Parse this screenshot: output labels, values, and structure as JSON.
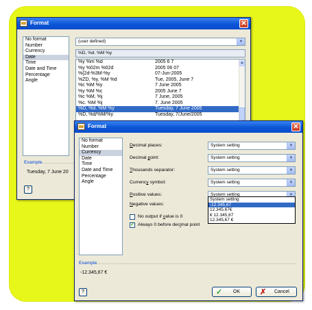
{
  "colors": {
    "backdrop": "#e8f71a",
    "title_blue": "#0b55d6",
    "selection": "#316ac5"
  },
  "back_window": {
    "title": "Format",
    "categories": [
      "No format",
      "Number",
      "Currency",
      "Date",
      "Time",
      "Date and Time",
      "Percentage",
      "Angle"
    ],
    "selected_category": "Date",
    "format_select_value": "(user defined)",
    "format_input_value": "%D, %d. %M %y",
    "format_rows": [
      [
        "%y %m %d",
        "2005 6 7"
      ],
      [
        "%y %02m %02d",
        "2005 06 07"
      ],
      [
        "%{2d-%3M-%y",
        "07-Jun-2005"
      ],
      [
        "%ZD, %y, %M %d",
        "Tue, 2005, June 7"
      ],
      [
        "%c %M %y",
        "7 June 2005"
      ],
      [
        "%y %M %c",
        "2005 June 7"
      ],
      [
        "%c %M, %j",
        "7 June, 2005"
      ],
      [
        "%c. %M %j",
        "7. June 2005"
      ],
      [
        "%D, %d. %M %y",
        "Tuesday, 7 June 2005"
      ],
      [
        "%D, %d/%M/%y",
        "Tuesday, 7/June/2005"
      ]
    ],
    "highlighted_row": 8,
    "example_label": "Example",
    "example_value": "Tuesday, 7 June 20"
  },
  "front_window": {
    "title": "Format",
    "categories": [
      "No format",
      "Number",
      "Currency",
      "Date",
      "Time",
      "Date and Time",
      "Percentage",
      "Angle"
    ],
    "selected_category": "Currency",
    "fields": [
      {
        "label": "Decimal places:",
        "mnemonic": "D",
        "rest": "ecimal places:",
        "value": "System setting"
      },
      {
        "label": "Decimal point:",
        "mnemonic": "p",
        "pre": "Decimal ",
        "rest": "oint:",
        "value": "System setting"
      },
      {
        "label": "Thousands separator:",
        "mnemonic": "T",
        "rest": "housands separator:",
        "value": "System setting"
      },
      {
        "label": "Currency symbol:",
        "mnemonic": "y",
        "pre": "Currenc",
        "rest": " symbol:",
        "value": "System setting"
      },
      {
        "label": "Positive values:",
        "mnemonic": "P",
        "rest": "ositive values:",
        "value": "System setting"
      }
    ],
    "negative_label": "Negative values:",
    "negative_mnemonic": "N",
    "negative_rest": "egative values:",
    "negative_options": [
      "System setting",
      "-12.345,67",
      "12.345,67€",
      "€ 12.345,67",
      "12.345,67 €"
    ],
    "negative_highlighted": 1,
    "no_output_label_pre": "No output if ",
    "no_output_mnemonic": "v",
    "no_output_label_rest": "alue is 0",
    "no_output_checked": false,
    "always_zero_label_pre": "Always 0 before dec",
    "always_zero_mnemonic": "i",
    "always_zero_label_rest": "mal point",
    "always_zero_checked": true,
    "example_label": "Example",
    "example_value": "-12.345,67 €",
    "ok_label": "OK",
    "cancel_label": "Cancel",
    "help_label": "?"
  }
}
